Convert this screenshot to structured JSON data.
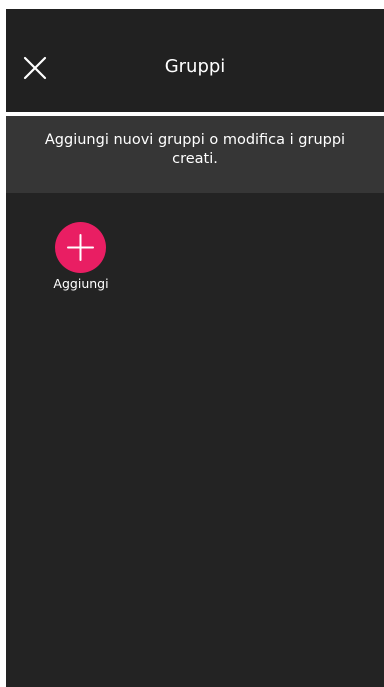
{
  "header": {
    "title": "Gruppi",
    "close_icon": "close-icon"
  },
  "info": {
    "text": "Aggiungi nuovi gruppi o modifica i gruppi creati."
  },
  "add_group": {
    "label": "Aggiungi",
    "icon": "plus-icon",
    "accent_color": "#e91e63"
  },
  "colors": {
    "background": "#232323",
    "header": "#212121",
    "banner": "#363636",
    "text": "#ffffff"
  }
}
